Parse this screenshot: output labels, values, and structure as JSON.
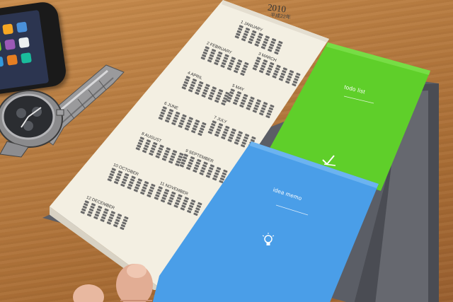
{
  "calendar": {
    "year": "2010",
    "era": "平成22年",
    "months": [
      {
        "label": "1 JANUARY"
      },
      {
        "label": "2 FEBRUARY"
      },
      {
        "label": "3 MARCH"
      },
      {
        "label": "4 APRIL"
      },
      {
        "label": "5 MAY"
      },
      {
        "label": "6 JUNE"
      },
      {
        "label": "7 JULY"
      },
      {
        "label": "8 AUGUST"
      },
      {
        "label": "9 SEPTEMBER"
      },
      {
        "label": "10 OCTOBER"
      },
      {
        "label": "11 NOVEMBER"
      },
      {
        "label": "12 DECEMBER"
      }
    ]
  },
  "todo_pad": {
    "title": "todo list",
    "color": "#5fcf2a",
    "icon": "checkmark-icon"
  },
  "idea_pad": {
    "title": "idea memo",
    "color": "#4a9ee8",
    "icon": "lightbulb-icon"
  },
  "colors": {
    "desk": "#b67a3f",
    "page": "#f3efe2",
    "cover": "#5b5e66"
  }
}
